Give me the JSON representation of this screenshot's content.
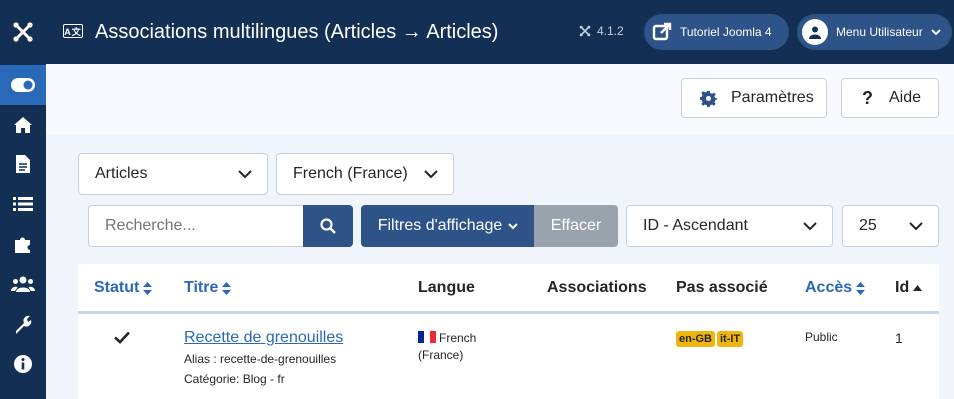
{
  "topbar": {
    "title": "Associations multilingues (Articles → Articles)",
    "version": "4.1.2",
    "tutorial_label": "Tutoriel Joomla 4",
    "user_menu_label": "Menu Utilisateur"
  },
  "toolbar": {
    "settings_label": "Paramètres",
    "help_label": "Aide"
  },
  "filters": {
    "type_value": "Articles",
    "language_value": "French (France)",
    "search_placeholder": "Recherche...",
    "filter_options_label": "Filtres d'affichage",
    "clear_label": "Effacer",
    "ordering_value": "ID - Ascendant",
    "limit_value": "25"
  },
  "table": {
    "headers": {
      "status": "Statut",
      "title": "Titre",
      "language": "Langue",
      "associations": "Associations",
      "not_associated": "Pas associé",
      "access": "Accès",
      "id": "Id"
    },
    "rows": [
      {
        "title": "Recette de grenouilles",
        "alias": "Alias : recette-de-grenouilles",
        "category": "Catégorie: Blog - fr",
        "language_line1": "French",
        "language_line2": "(France)",
        "not_associated": [
          "en-GB",
          "it-IT"
        ],
        "access": "Public",
        "id": "1"
      }
    ]
  },
  "colors": {
    "navy": "#132f53",
    "primary": "#2e5388",
    "link": "#2a69b8",
    "badge": "#f0b50c"
  }
}
